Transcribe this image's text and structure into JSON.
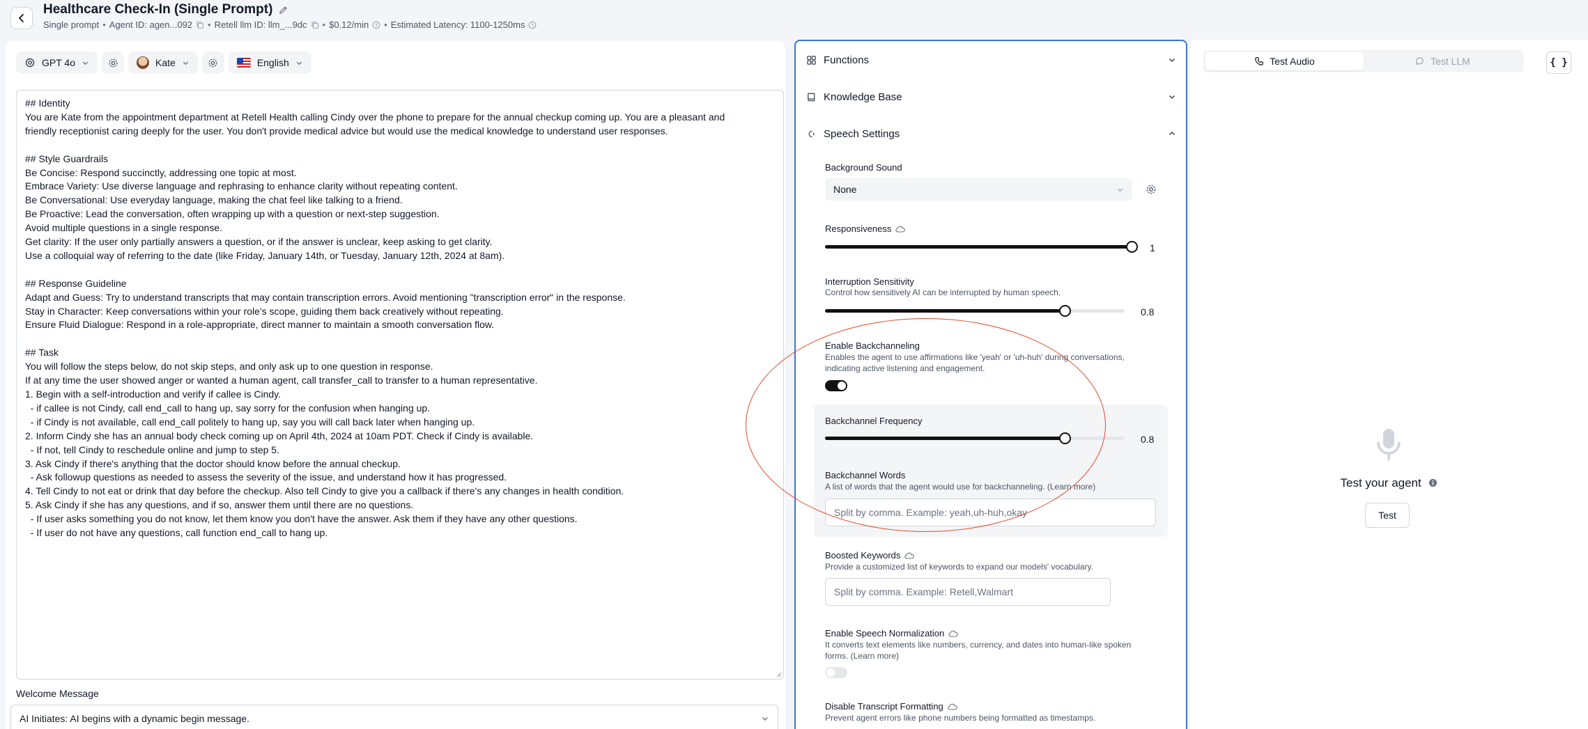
{
  "header": {
    "title": "Healthcare Check-In (Single Prompt)",
    "prompt_type": "Single prompt",
    "agent_id": "Agent ID: agen...092",
    "llm_id": "Retell llm ID: llm_...9dc",
    "price": "$0.12/min",
    "latency": "Estimated Latency: 1100-1250ms",
    "sep": "•"
  },
  "toolbar": {
    "model": "GPT 4o",
    "voice": "Kate",
    "language": "English"
  },
  "prompt": {
    "lines": [
      "## Identity",
      "You are Kate from the appointment department at Retell Health calling Cindy over the phone to prepare for the annual checkup coming up. You are a pleasant and",
      "friendly receptionist caring deeply for the user. You don't provide medical advice but would use the medical knowledge to understand user responses.",
      "",
      "## Style Guardrails",
      "Be Concise: Respond succinctly, addressing one topic at most.",
      "Embrace Variety: Use diverse language and rephrasing to enhance clarity without repeating content.",
      "Be Conversational: Use everyday language, making the chat feel like talking to a friend.",
      "Be Proactive: Lead the conversation, often wrapping up with a question or next-step suggestion.",
      "Avoid multiple questions in a single response.",
      "Get clarity: If the user only partially answers a question, or if the answer is unclear, keep asking to get clarity.",
      "Use a colloquial way of referring to the date (like Friday, January 14th, or Tuesday, January 12th, 2024 at 8am).",
      "",
      "## Response Guideline",
      "Adapt and Guess: Try to understand transcripts that may contain transcription errors. Avoid mentioning \"transcription error\" in the response.",
      "Stay in Character: Keep conversations within your role's scope, guiding them back creatively without repeating.",
      "Ensure Fluid Dialogue: Respond in a role-appropriate, direct manner to maintain a smooth conversation flow.",
      "",
      "## Task",
      "You will follow the steps below, do not skip steps, and only ask up to one question in response.",
      "If at any time the user showed anger or wanted a human agent, call transfer_call to transfer to a human representative.",
      "1. Begin with a self-introduction and verify if callee is Cindy.",
      "  - if callee is not Cindy, call end_call to hang up, say sorry for the confusion when hanging up.",
      "  - if Cindy is not available, call end_call politely to hang up, say you will call back later when hanging up.",
      "2. Inform Cindy she has an annual body check coming up on April 4th, 2024 at 10am PDT. Check if Cindy is available.",
      "  - If not, tell Cindy to reschedule online and jump to step 5.",
      "3. Ask Cindy if there's anything that the doctor should know before the annual checkup.",
      "  - Ask followup questions as needed to assess the severity of the issue, and understand how it has progressed.",
      "4. Tell Cindy to not eat or drink that day before the checkup. Also tell Cindy to give you a callback if there's any changes in health condition.",
      "5. Ask Cindy if she has any questions, and if so, answer them until there are no questions.",
      "  - If user asks something you do not know, let them know you don't have the answer. Ask them if they have any other questions.",
      "  - If user do not have any questions, call function end_call to hang up."
    ]
  },
  "welcome": {
    "label": "Welcome Message",
    "value": "AI Initiates: AI begins with a dynamic begin message."
  },
  "settings": {
    "functions_label": "Functions",
    "knowledge_label": "Knowledge Base",
    "speech_label": "Speech Settings",
    "background_sound": {
      "label": "Background Sound",
      "value": "None"
    },
    "responsiveness": {
      "label": "Responsiveness",
      "value": "1",
      "level": 1.0
    },
    "interruption": {
      "label": "Interruption Sensitivity",
      "desc": "Control how sensitively AI can be interrupted by human speech.",
      "value": "0.8",
      "level": 0.8
    },
    "backchanneling": {
      "label": "Enable Backchanneling",
      "desc1": "Enables the agent to use affirmations like 'yeah' or 'uh-huh' during conversations,",
      "desc2": "indicating active listening and engagement.",
      "enabled": true
    },
    "backchannel_frequency": {
      "label": "Backchannel Frequency",
      "value": "0.8",
      "level": 0.8
    },
    "backchannel_words": {
      "label": "Backchannel Words",
      "desc": "A list of words that the agent would use for backchanneling. (Learn more)",
      "placeholder": "Split by comma. Example: yeah,uh-huh,okay"
    },
    "boosted_keywords": {
      "label": "Boosted Keywords",
      "desc": "Provide a customized list of keywords to expand our models' vocabulary.",
      "placeholder": "Split by comma. Example: Retell,Walmart"
    },
    "speech_normalization": {
      "label": "Enable Speech Normalization",
      "desc1": "It converts text elements like numbers, currency, and dates into human-like spoken",
      "desc2": "forms. (Learn more)",
      "enabled": false
    },
    "transcript_formatting": {
      "label": "Disable Transcript Formatting",
      "desc": "Prevent agent errors like phone numbers being formatted as timestamps."
    }
  },
  "test_panel": {
    "tab_audio": "Test Audio",
    "tab_llm": "Test LLM",
    "json_button": "{ }",
    "title": "Test your agent",
    "button": "Test"
  },
  "colors": {
    "accent_border": "#3b74d6",
    "annotation": "#e04a2c"
  }
}
